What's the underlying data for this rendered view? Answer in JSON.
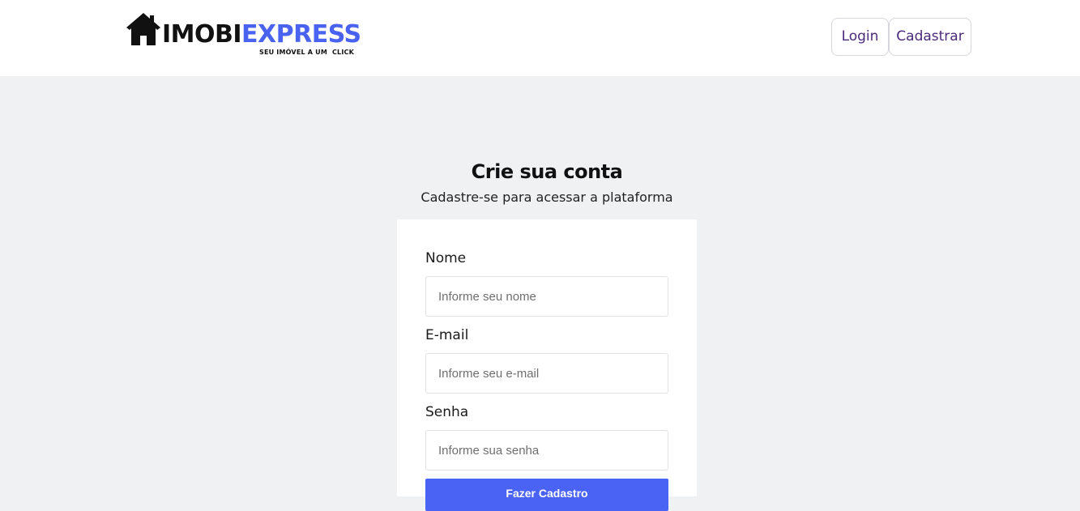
{
  "logo": {
    "part1": "IMOBI",
    "part2": "EXPRESS",
    "tagline": "SEU IMÓVEL A UM  CLICK",
    "icon": "house-icon",
    "colors": {
      "dark": "#111111",
      "accent": "#4a62f0"
    }
  },
  "nav": {
    "login_label": "Login",
    "signup_label": "Cadastrar"
  },
  "form": {
    "title": "Crie sua conta",
    "subtitle": "Cadastre-se para acessar a plataforma",
    "fields": [
      {
        "label": "Nome",
        "placeholder": "Informe seu nome",
        "value": ""
      },
      {
        "label": "E-mail",
        "placeholder": "Informe seu e-mail",
        "value": ""
      },
      {
        "label": "Senha",
        "placeholder": "Informe sua senha",
        "value": ""
      }
    ],
    "submit_label": "Fazer Cadastro"
  },
  "colors": {
    "page_background": "#f0f1f3",
    "button_primary": "#4a63f5",
    "nav_text": "#4b2a7a"
  }
}
